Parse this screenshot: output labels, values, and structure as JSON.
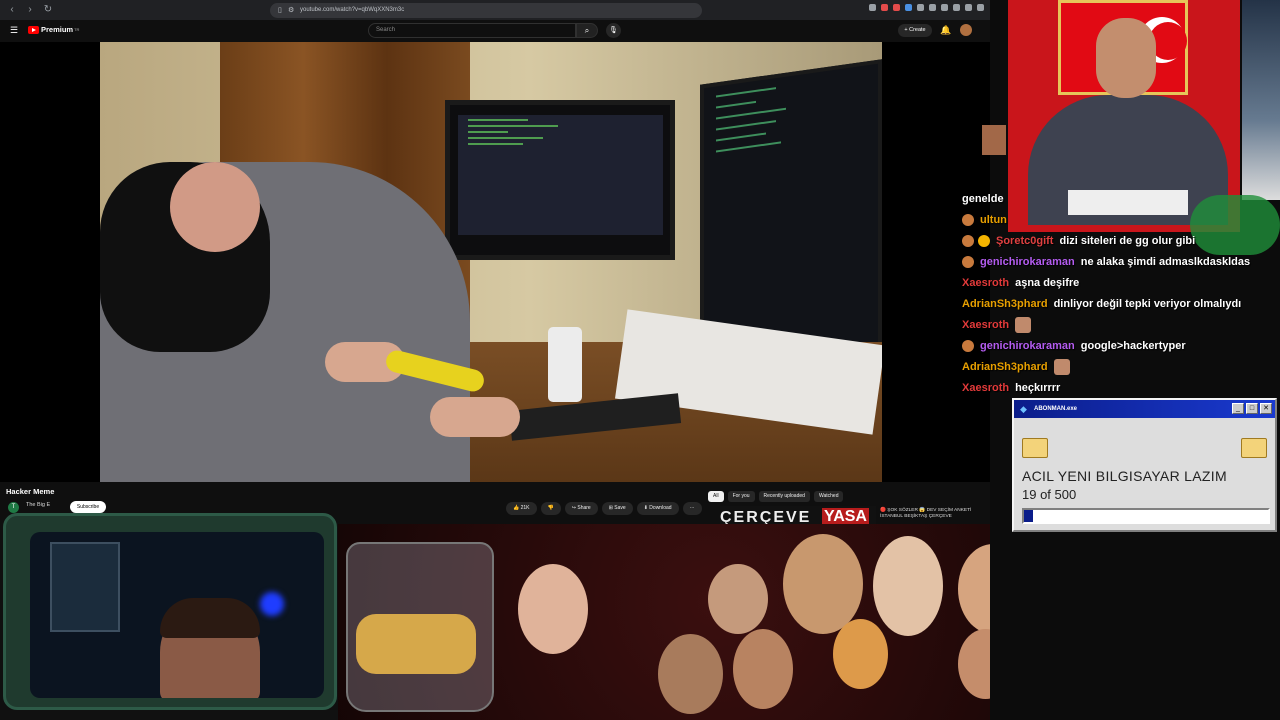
{
  "browser": {
    "url": "youtube.com/watch?v=qbWqXXN3m3c",
    "icons": [
      "back-icon",
      "forward-icon",
      "reload-icon",
      "bookmark-icon",
      "extension-icons"
    ]
  },
  "youtube": {
    "logo_text": "Premium",
    "logo_suffix": "TR",
    "search_placeholder": "Search",
    "create_label": "Create"
  },
  "video": {
    "title": "Hacker Meme",
    "channel_name": "The Big E",
    "channel_initial": "T",
    "subscribe_label": "Subscribe",
    "likes": "21K",
    "share_label": "Share",
    "save_label": "Save",
    "download_label": "Download",
    "more_label": "···"
  },
  "recommendations": {
    "chips": [
      "All",
      "For you",
      "Recently uploaded",
      "Watched"
    ],
    "active_chip": "All",
    "thumb_text": "ÇERÇEVE",
    "thumb_highlight": "YASA",
    "reco_title": "🔴 ŞOK SÖZLER 😱 DEV SEÇİM ANKETİ İSTANBUL BEŞİKTAŞ ÇERÇEVE"
  },
  "chat": {
    "lines": [
      {
        "user": "",
        "message": "genelde",
        "user_color": "#ffffff",
        "badge": false
      },
      {
        "user": "ultun",
        "message": "",
        "user_color": "#e8a000",
        "badge": true
      },
      {
        "user": "Şoretc0gift",
        "message": "dizi siteleri de gg olur gibi",
        "user_color": "#e04040",
        "badge": true,
        "badge2": true
      },
      {
        "user": "genichirokaraman",
        "message": "ne alaka şimdi admaslkdaskldas",
        "user_color": "#b45cf0",
        "badge": true
      },
      {
        "user": "Xaesroth",
        "message": "aşna deşifre",
        "user_color": "#e23a3a",
        "badge": false
      },
      {
        "user": "AdrianSh3phard",
        "message": "dinliyor değil tepki veriyor olmalıydı",
        "user_color": "#e8a000",
        "badge": false
      },
      {
        "user": "Xaesroth",
        "message": "",
        "user_color": "#e23a3a",
        "badge": false,
        "emote": true
      },
      {
        "user": "genichirokaraman",
        "message": "google>hackertyper",
        "user_color": "#b45cf0",
        "badge": true
      },
      {
        "user": "AdrianSh3phard",
        "message": "",
        "user_color": "#e8a000",
        "badge": false,
        "emote": true
      },
      {
        "user": "Xaesroth",
        "message": "heçkırrrr",
        "user_color": "#e23a3a",
        "badge": false
      }
    ]
  },
  "popup": {
    "title": "ABONMAN.exe",
    "message": "ACIL YENI BILGISAYAR LAZIM",
    "count": "19 of 500",
    "progress_fraction": 0.038,
    "minimize": "_",
    "maximize": "□",
    "close": "✕"
  },
  "colors": {
    "youtube_red": "#ff0000",
    "popup_titlebar": "#0b1d8a",
    "progress_fill": "#0b1d8a"
  }
}
